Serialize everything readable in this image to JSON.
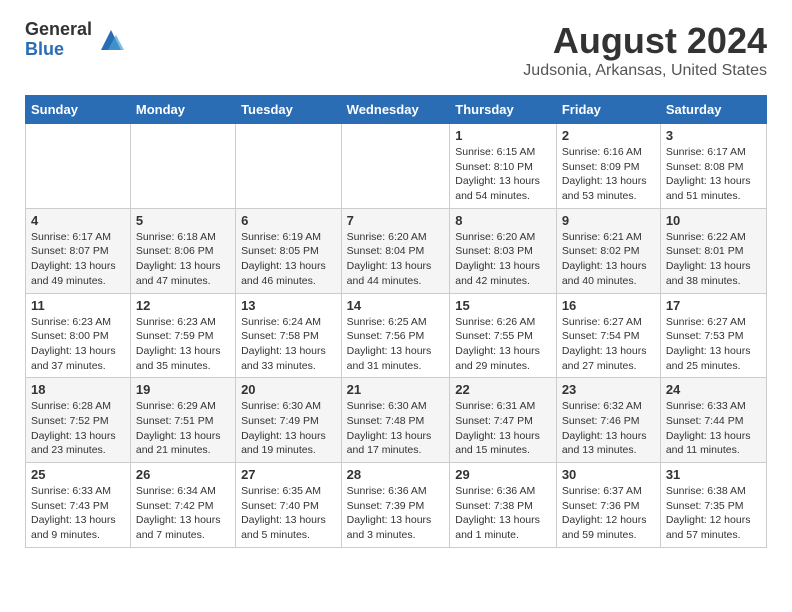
{
  "logo": {
    "general": "General",
    "blue": "Blue"
  },
  "header": {
    "month": "August 2024",
    "location": "Judsonia, Arkansas, United States"
  },
  "days_of_week": [
    "Sunday",
    "Monday",
    "Tuesday",
    "Wednesday",
    "Thursday",
    "Friday",
    "Saturday"
  ],
  "weeks": [
    [
      {
        "day": "",
        "info": ""
      },
      {
        "day": "",
        "info": ""
      },
      {
        "day": "",
        "info": ""
      },
      {
        "day": "",
        "info": ""
      },
      {
        "day": "1",
        "info": "Sunrise: 6:15 AM\nSunset: 8:10 PM\nDaylight: 13 hours\nand 54 minutes."
      },
      {
        "day": "2",
        "info": "Sunrise: 6:16 AM\nSunset: 8:09 PM\nDaylight: 13 hours\nand 53 minutes."
      },
      {
        "day": "3",
        "info": "Sunrise: 6:17 AM\nSunset: 8:08 PM\nDaylight: 13 hours\nand 51 minutes."
      }
    ],
    [
      {
        "day": "4",
        "info": "Sunrise: 6:17 AM\nSunset: 8:07 PM\nDaylight: 13 hours\nand 49 minutes."
      },
      {
        "day": "5",
        "info": "Sunrise: 6:18 AM\nSunset: 8:06 PM\nDaylight: 13 hours\nand 47 minutes."
      },
      {
        "day": "6",
        "info": "Sunrise: 6:19 AM\nSunset: 8:05 PM\nDaylight: 13 hours\nand 46 minutes."
      },
      {
        "day": "7",
        "info": "Sunrise: 6:20 AM\nSunset: 8:04 PM\nDaylight: 13 hours\nand 44 minutes."
      },
      {
        "day": "8",
        "info": "Sunrise: 6:20 AM\nSunset: 8:03 PM\nDaylight: 13 hours\nand 42 minutes."
      },
      {
        "day": "9",
        "info": "Sunrise: 6:21 AM\nSunset: 8:02 PM\nDaylight: 13 hours\nand 40 minutes."
      },
      {
        "day": "10",
        "info": "Sunrise: 6:22 AM\nSunset: 8:01 PM\nDaylight: 13 hours\nand 38 minutes."
      }
    ],
    [
      {
        "day": "11",
        "info": "Sunrise: 6:23 AM\nSunset: 8:00 PM\nDaylight: 13 hours\nand 37 minutes."
      },
      {
        "day": "12",
        "info": "Sunrise: 6:23 AM\nSunset: 7:59 PM\nDaylight: 13 hours\nand 35 minutes."
      },
      {
        "day": "13",
        "info": "Sunrise: 6:24 AM\nSunset: 7:58 PM\nDaylight: 13 hours\nand 33 minutes."
      },
      {
        "day": "14",
        "info": "Sunrise: 6:25 AM\nSunset: 7:56 PM\nDaylight: 13 hours\nand 31 minutes."
      },
      {
        "day": "15",
        "info": "Sunrise: 6:26 AM\nSunset: 7:55 PM\nDaylight: 13 hours\nand 29 minutes."
      },
      {
        "day": "16",
        "info": "Sunrise: 6:27 AM\nSunset: 7:54 PM\nDaylight: 13 hours\nand 27 minutes."
      },
      {
        "day": "17",
        "info": "Sunrise: 6:27 AM\nSunset: 7:53 PM\nDaylight: 13 hours\nand 25 minutes."
      }
    ],
    [
      {
        "day": "18",
        "info": "Sunrise: 6:28 AM\nSunset: 7:52 PM\nDaylight: 13 hours\nand 23 minutes."
      },
      {
        "day": "19",
        "info": "Sunrise: 6:29 AM\nSunset: 7:51 PM\nDaylight: 13 hours\nand 21 minutes."
      },
      {
        "day": "20",
        "info": "Sunrise: 6:30 AM\nSunset: 7:49 PM\nDaylight: 13 hours\nand 19 minutes."
      },
      {
        "day": "21",
        "info": "Sunrise: 6:30 AM\nSunset: 7:48 PM\nDaylight: 13 hours\nand 17 minutes."
      },
      {
        "day": "22",
        "info": "Sunrise: 6:31 AM\nSunset: 7:47 PM\nDaylight: 13 hours\nand 15 minutes."
      },
      {
        "day": "23",
        "info": "Sunrise: 6:32 AM\nSunset: 7:46 PM\nDaylight: 13 hours\nand 13 minutes."
      },
      {
        "day": "24",
        "info": "Sunrise: 6:33 AM\nSunset: 7:44 PM\nDaylight: 13 hours\nand 11 minutes."
      }
    ],
    [
      {
        "day": "25",
        "info": "Sunrise: 6:33 AM\nSunset: 7:43 PM\nDaylight: 13 hours\nand 9 minutes."
      },
      {
        "day": "26",
        "info": "Sunrise: 6:34 AM\nSunset: 7:42 PM\nDaylight: 13 hours\nand 7 minutes."
      },
      {
        "day": "27",
        "info": "Sunrise: 6:35 AM\nSunset: 7:40 PM\nDaylight: 13 hours\nand 5 minutes."
      },
      {
        "day": "28",
        "info": "Sunrise: 6:36 AM\nSunset: 7:39 PM\nDaylight: 13 hours\nand 3 minutes."
      },
      {
        "day": "29",
        "info": "Sunrise: 6:36 AM\nSunset: 7:38 PM\nDaylight: 13 hours\nand 1 minute."
      },
      {
        "day": "30",
        "info": "Sunrise: 6:37 AM\nSunset: 7:36 PM\nDaylight: 12 hours\nand 59 minutes."
      },
      {
        "day": "31",
        "info": "Sunrise: 6:38 AM\nSunset: 7:35 PM\nDaylight: 12 hours\nand 57 minutes."
      }
    ]
  ]
}
